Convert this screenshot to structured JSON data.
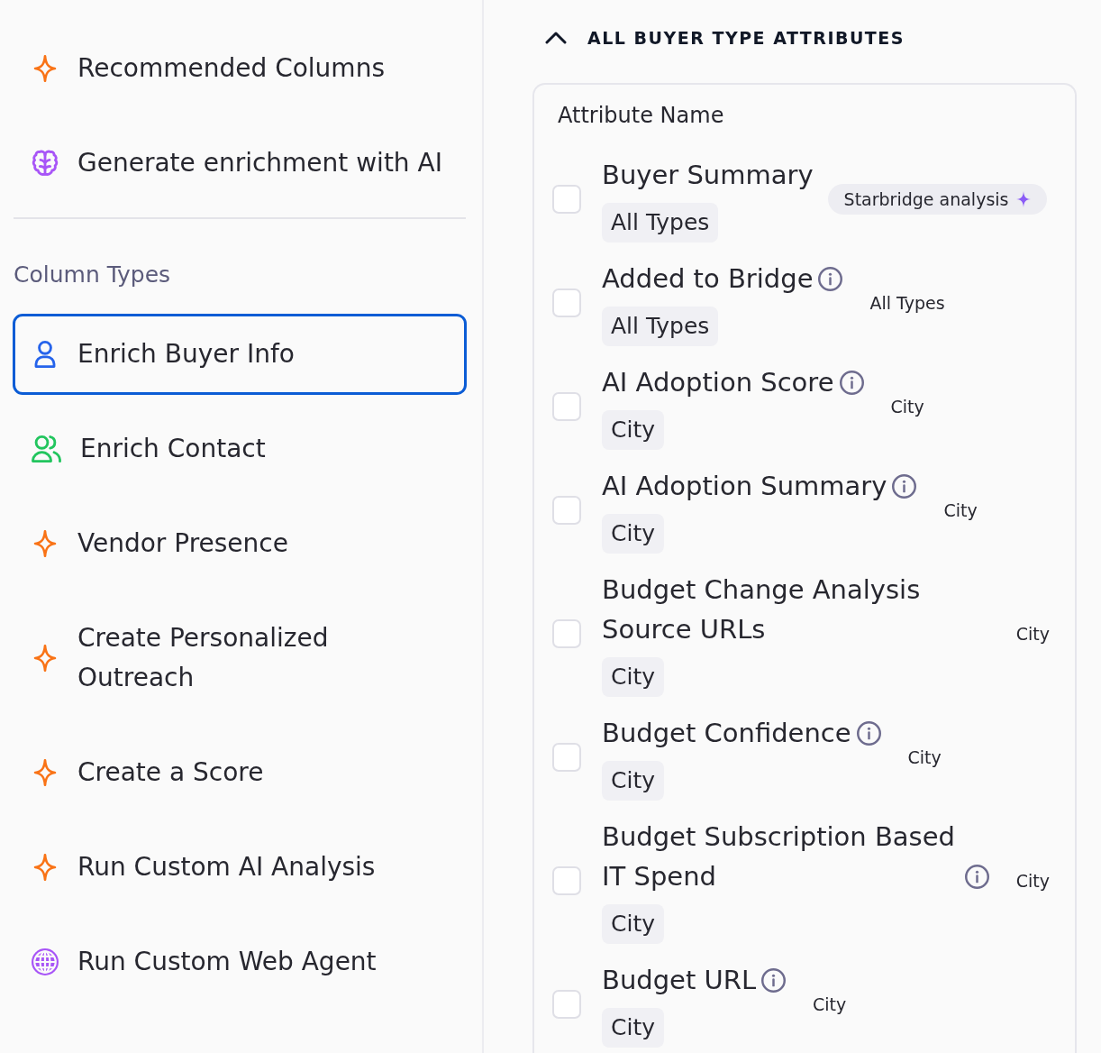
{
  "sidebar": {
    "top_items": [
      {
        "label": "Recommended Columns",
        "kind": "sparkle",
        "selected": false
      },
      {
        "label": "Generate enrichment with AI",
        "kind": "brain",
        "selected": false
      }
    ],
    "column_types": {
      "heading": "Column Types",
      "items": [
        {
          "label": "Enrich Buyer Info",
          "kind": "user",
          "selected": true
        },
        {
          "label": "Enrich Contact",
          "kind": "users",
          "selected": false
        },
        {
          "label": "Vendor Presence",
          "kind": "sparkle",
          "selected": false
        },
        {
          "label": "Create Personalized Outreach",
          "kind": "sparkle",
          "selected": false
        },
        {
          "label": "Create a Score",
          "kind": "sparkle",
          "selected": false
        },
        {
          "label": "Run Custom AI Analysis",
          "kind": "sparkle",
          "selected": false
        },
        {
          "label": "Run Custom Web Agent",
          "kind": "globe",
          "selected": false
        }
      ]
    }
  },
  "attributes": {
    "title": "ALL BUYER TYPE ATTRIBUTES",
    "expanded": true,
    "table": {
      "column_header": "Attribute Name",
      "rows": [
        {
          "name": "Buyer Summary",
          "info": false,
          "tag": "All Types",
          "checked": false,
          "aside": {
            "kind": "badge",
            "text": "Starbridge analysis"
          }
        },
        {
          "name": "Added to Bridge",
          "info": true,
          "tag": "All Types",
          "checked": false,
          "aside": {
            "kind": "text",
            "text": "All Types"
          }
        },
        {
          "name": "AI Adoption Score",
          "info": true,
          "tag": "City",
          "checked": false,
          "aside": {
            "kind": "text",
            "text": "City"
          }
        },
        {
          "name": "AI Adoption Summary",
          "info": true,
          "tag": "City",
          "checked": false,
          "aside": {
            "kind": "text",
            "text": "City"
          }
        },
        {
          "name": "Budget Change Analysis Source URLs",
          "info": false,
          "tag": "City",
          "checked": false,
          "aside": {
            "kind": "text",
            "text": "City"
          }
        },
        {
          "name": "Budget Confidence",
          "info": true,
          "tag": "City",
          "checked": false,
          "aside": {
            "kind": "text",
            "text": "City"
          }
        },
        {
          "name": "Budget Subscription Based IT Spend",
          "info": true,
          "tag": "City",
          "checked": false,
          "aside": {
            "kind": "text",
            "text": "City"
          }
        },
        {
          "name": "Budget URL",
          "info": true,
          "tag": "City",
          "checked": false,
          "aside": {
            "kind": "text",
            "text": "City"
          }
        }
      ]
    }
  }
}
